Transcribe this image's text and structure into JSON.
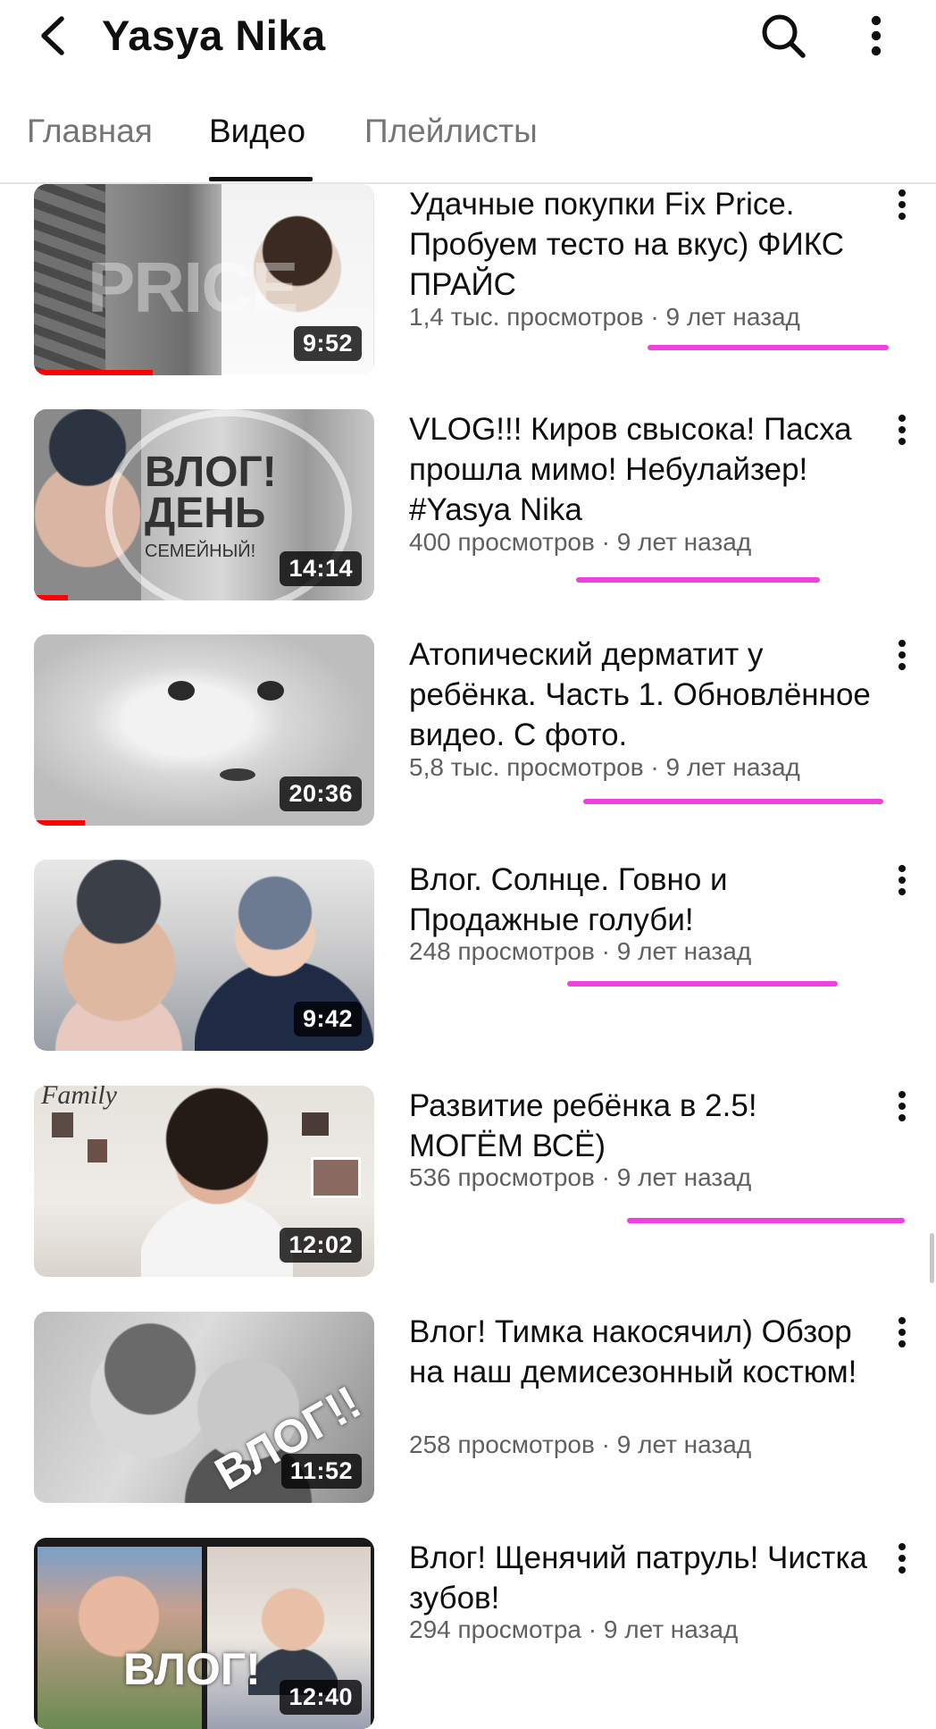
{
  "header": {
    "channel_name": "Yasya Nika",
    "back_icon": "chevron-left-icon",
    "search_icon": "search-icon",
    "more_icon": "more-vert-icon"
  },
  "tabs": [
    {
      "label": "Главная",
      "active": false
    },
    {
      "label": "Видео",
      "active": true
    },
    {
      "label": "Плейлисты",
      "active": false
    }
  ],
  "videos": [
    {
      "title": "Удачные покупки Fix Price. Пробуем тесто на вкус) ФИКС ПРАЙС",
      "views": "1,4 тыс. просмотров",
      "age": "9 лет назад",
      "duration": "9:52",
      "progress": 0.35,
      "thumb_text": "PRICE"
    },
    {
      "title": "VLOG!!! Киров свысока! Пасха прошла мимо! Небулайзер! #Yasya Nika",
      "views": "400 просмотров",
      "age": "9 лет назад",
      "duration": "14:14",
      "progress": 0.1,
      "thumb_text": "ВЛОГ! ДЕНЬ",
      "thumb_subtext": "СЕМЕЙНЫЙ!"
    },
    {
      "title": "Атопический дерматит у ребёнка. Часть 1. Обновлённое видео. С фото.",
      "views": "5,8 тыс. просмотров",
      "age": "9 лет назад",
      "duration": "20:36",
      "progress": 0.15
    },
    {
      "title": "Влог. Солнце. Говно  и Продажные голуби!",
      "views": "248 просмотров",
      "age": "9 лет назад",
      "duration": "9:42",
      "progress": 0
    },
    {
      "title": "Развитие ребёнка в 2.5! МОГЁМ ВСЁ)",
      "views": "536 просмотров",
      "age": "9 лет назад",
      "duration": "12:02",
      "progress": 0,
      "thumb_text": "Family"
    },
    {
      "title": "Влог! Тимка накосячил) Обзор на наш демисезонный костюм!",
      "views": "258 просмотров",
      "age": "9 лет назад",
      "duration": "11:52",
      "progress": 0,
      "thumb_text": "ВЛОГ!!"
    },
    {
      "title": "Влог! Щенячий патруль! Чистка зубов!",
      "views": "294 просмотра",
      "age": "9 лет назад",
      "duration": "12:40",
      "progress": 0,
      "thumb_text": "ВЛОГ!"
    }
  ],
  "colors": {
    "annotation_underline": "#f040e0",
    "progress_red": "#ff0000",
    "meta_gray": "#606060"
  }
}
